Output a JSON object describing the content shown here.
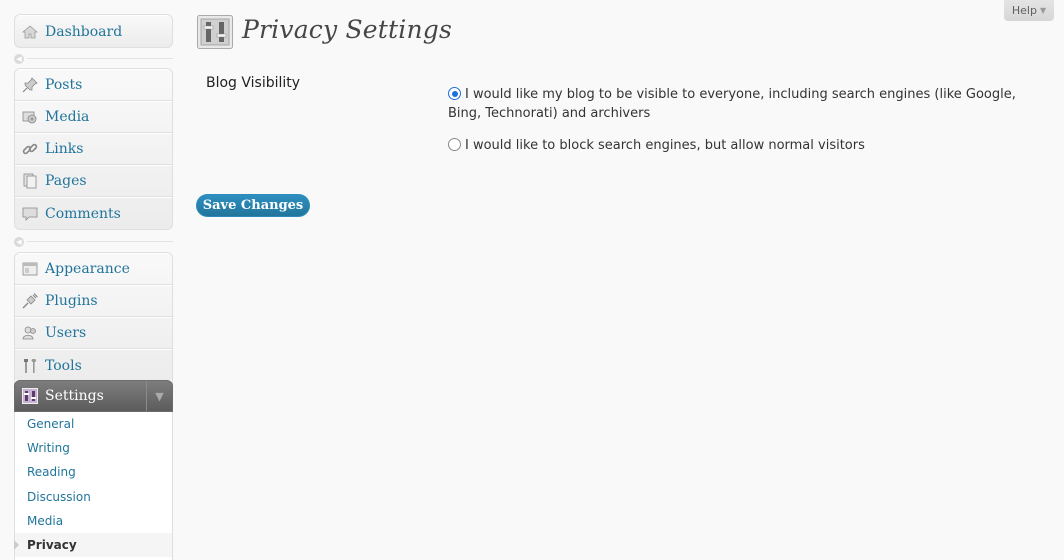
{
  "help": {
    "label": "Help"
  },
  "page": {
    "title": "Privacy Settings"
  },
  "menu": {
    "dashboard": "Dashboard",
    "group2": [
      "Posts",
      "Media",
      "Links",
      "Pages",
      "Comments"
    ],
    "group3": [
      "Appearance",
      "Plugins",
      "Users",
      "Tools"
    ],
    "settings": {
      "label": "Settings",
      "submenu": [
        "General",
        "Writing",
        "Reading",
        "Discussion",
        "Media",
        "Privacy"
      ],
      "current": "Privacy"
    }
  },
  "form": {
    "label": "Blog Visibility",
    "options": [
      {
        "text": "I would like my blog to be visible to everyone, including search engines (like Google, Bing, Technorati) and archivers",
        "checked": true
      },
      {
        "text": "I would like to block search engines, but allow normal visitors",
        "checked": false
      }
    ],
    "save_label": "Save Changes"
  },
  "colors": {
    "link": "#21759b",
    "button": "#21759b",
    "active_menu": "#6d6d6d"
  }
}
